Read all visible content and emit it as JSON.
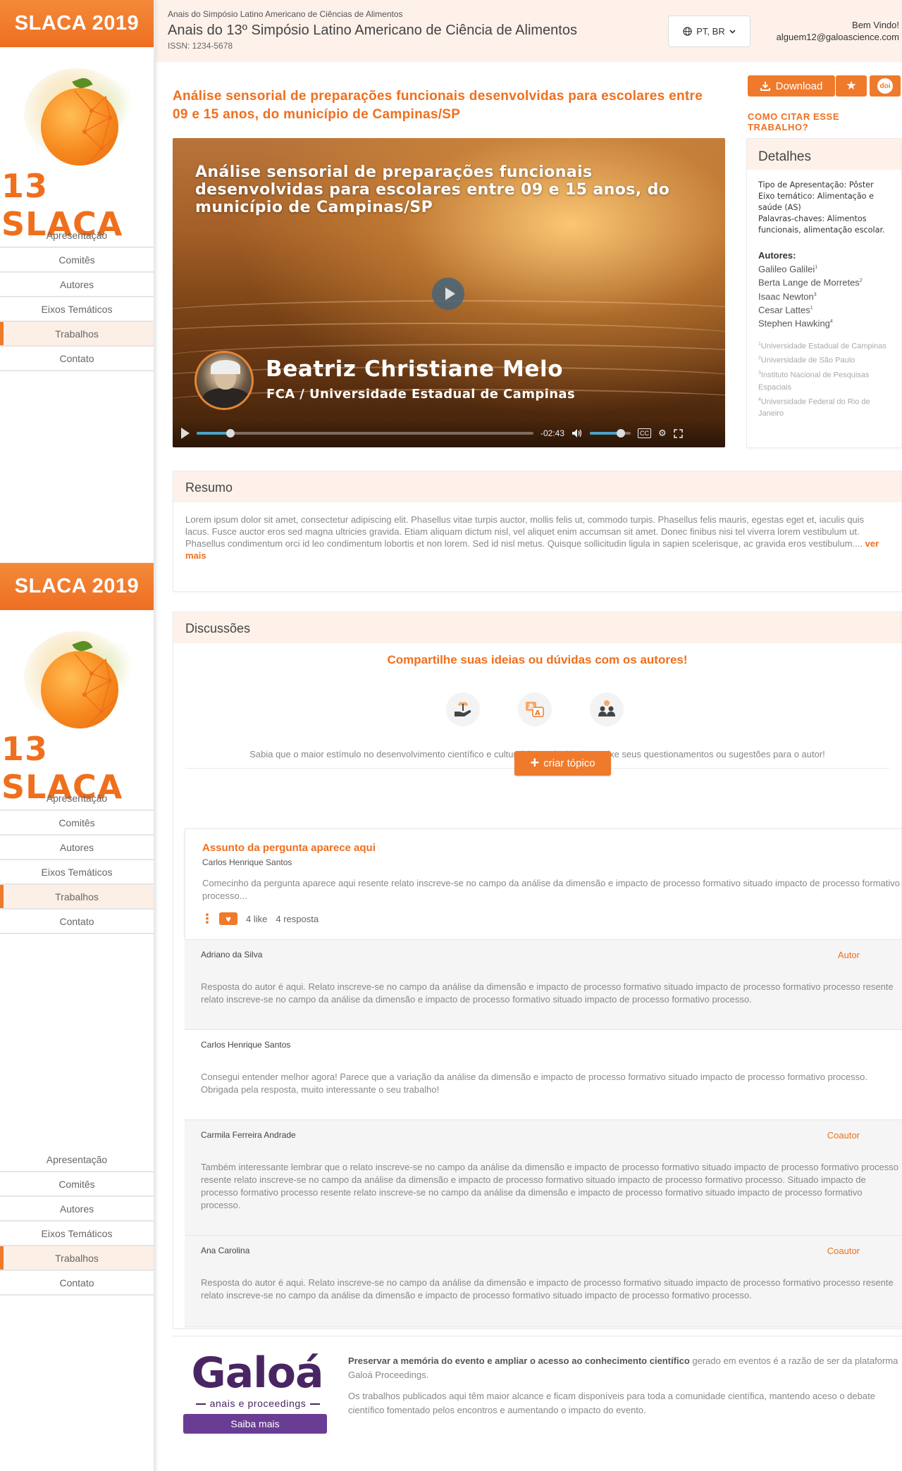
{
  "brand": {
    "header": "SLACA 2019",
    "logo_text": "13 SLACA"
  },
  "sidebar": {
    "items": [
      {
        "label": "Apresentação"
      },
      {
        "label": "Comitês"
      },
      {
        "label": "Autores"
      },
      {
        "label": "Eixos Temáticos"
      },
      {
        "label": "Trabalhos"
      },
      {
        "label": "Contato"
      }
    ],
    "active": "Trabalhos"
  },
  "header": {
    "event_small": "Anais do Simpósio Latino Americano de Ciências de Alimentos",
    "event_title": "Anais do 13º Simpósio Latino Americano de Ciência de Alimentos",
    "issn": "ISSN: 1234-5678",
    "language": "PT, BR",
    "welcome": "Bem Vindo!",
    "email": "alguem12@galoascience.com"
  },
  "paper": {
    "title": "Análise sensorial de preparações funcionais desenvolvidas para escolares entre 09 e 15 anos, do município de Campinas/SP",
    "download_label": "Download",
    "doi_label": "doi",
    "cite_label": "COMO CITAR ESSE TRABALHO?"
  },
  "video": {
    "title": "Análise sensorial de preparações funcionais desenvolvidas para escolares entre 09 e 15 anos, do município de Campinas/SP",
    "speaker_name": "Beatriz Christiane Melo",
    "speaker_affiliation": "FCA / Universidade Estadual de Campinas",
    "time_remaining": "-02:43",
    "progress": 0.1,
    "volume": 0.75,
    "cc_label": "CC"
  },
  "details": {
    "heading": "Detalhes",
    "presentation_type": "Tipo de Apresentação: Pôster",
    "theme": "Eixo temático: Alimentação e saúde (AS)",
    "keywords": "Palavras-chaves: Alimentos funcionais, alimentação escolar.",
    "authors_label": "Autores:",
    "authors": [
      {
        "name": "Galileo Galilei",
        "ref": "1"
      },
      {
        "name": "Berta Lange de Morretes",
        "ref": "2"
      },
      {
        "name": "Isaac Newton",
        "ref": "3"
      },
      {
        "name": "Cesar Lattes",
        "ref": "1"
      },
      {
        "name": "Stephen Hawking",
        "ref": "4"
      }
    ],
    "institutions": [
      {
        "ref": "1",
        "name": "Universidade Estadual de Campinas"
      },
      {
        "ref": "2",
        "name": "Universidade de São Paulo"
      },
      {
        "ref": "3",
        "name": "Instituto Nacional de Pesquisas Espaciais"
      },
      {
        "ref": "4",
        "name": "Universidade Federal do Rio de Janeiro"
      }
    ]
  },
  "resumo": {
    "heading": "Resumo",
    "text": "Lorem ipsum dolor sit amet, consectetur adipiscing elit. Phasellus vitae turpis auctor, mollis felis ut, commodo turpis. Phasellus felis mauris, egestas eget et, iaculis quis lacus. Fusce auctor eros sed magna ultricies gravida. Etiam aliquam dictum nisl, vel aliquet enim accumsan sit amet. Donec finibus nisi tel viverra lorem vestibulum ut. Phasellus condimentum orci id leo condimentum lobortis et non lorem. Sed id nisl metus. Quisque sollicitudin ligula in sapien scelerisque, ac gravida eros vestibulum....",
    "more_label": "ver mais"
  },
  "discussions": {
    "heading": "Discussões",
    "cta": "Compartilhe suas ideias ou dúvidas com os autores!",
    "icons": [
      "seedling-hand-icon",
      "translate-icon",
      "people-icon"
    ],
    "info": "Sabia que o maior estímulo no desenvolvimento científico e cultural é a curiosidade? Deixe seus questionamentos ou sugestões para o autor!",
    "create_label": "criar tópico",
    "topic": {
      "title": "Assunto da pergunta aparece aqui",
      "author": "Carlos Henrique Santos",
      "text": "Comecinho da pergunta aparece aqui resente relato inscreve-se no campo da análise da dimensão e impacto de processo formativo situado impacto de processo formativo processo...",
      "likes": "4 like",
      "replies_count": "4 resposta"
    },
    "replies": [
      {
        "author": "Adriano da Silva",
        "role": "Autor",
        "text": "Resposta do autor é aqui. Relato inscreve-se no campo da análise da dimensão e impacto de processo formativo situado impacto de processo formativo processo resente relato inscreve-se no campo da análise da dimensão e impacto de processo formativo situado impacto de processo formativo processo."
      },
      {
        "author": "Carlos Henrique Santos",
        "role": "",
        "text": "Consegui entender melhor agora! Parece que a variação da análise da dimensão e impacto de processo formativo situado impacto de processo formativo processo. Obrigada pela resposta, muito interessante o seu trabalho!"
      },
      {
        "author": "Carmila Ferreira Andrade",
        "role": "Coautor",
        "text": "Também interessante lembrar que o relato inscreve-se no campo da análise da dimensão e impacto de processo formativo situado impacto de processo formativo processo resente relato inscreve-se no campo da análise da dimensão e impacto de processo formativo situado impacto de processo formativo processo. Situado impacto de processo formativo processo resente relato inscreve-se no campo da análise da dimensão e impacto de processo formativo situado impacto de processo formativo processo."
      },
      {
        "author": "Ana Carolina",
        "role": "Coautor",
        "text": "Resposta do autor é aqui. Relato inscreve-se no campo da análise da dimensão e impacto de processo formativo situado impacto de processo formativo processo resente relato inscreve-se no campo da análise da dimensão e impacto de processo formativo situado impacto de processo formativo processo."
      }
    ]
  },
  "footer": {
    "logo": "Galoá",
    "logo_sub": "anais e proceedings",
    "button_label": "Saiba mais",
    "p1_bold": "Preservar a memória do evento e ampliar o acesso ao conhecimento científico",
    "p1_rest": " gerado em eventos é a razão de ser da plataforma Galoá Proceedings.",
    "p2": "Os trabalhos publicados aqui têm maior alcance e ficam disponíveis para toda a comunidade científica, mantendo aceso o debate científico fomentado pelos encontros e aumentando o impacto do evento."
  },
  "colors": {
    "accent": "#f07a2b",
    "accent_text": "#ef6f1d",
    "header_bg": "#fdf1ea",
    "galoa_purple": "#4a2563"
  }
}
